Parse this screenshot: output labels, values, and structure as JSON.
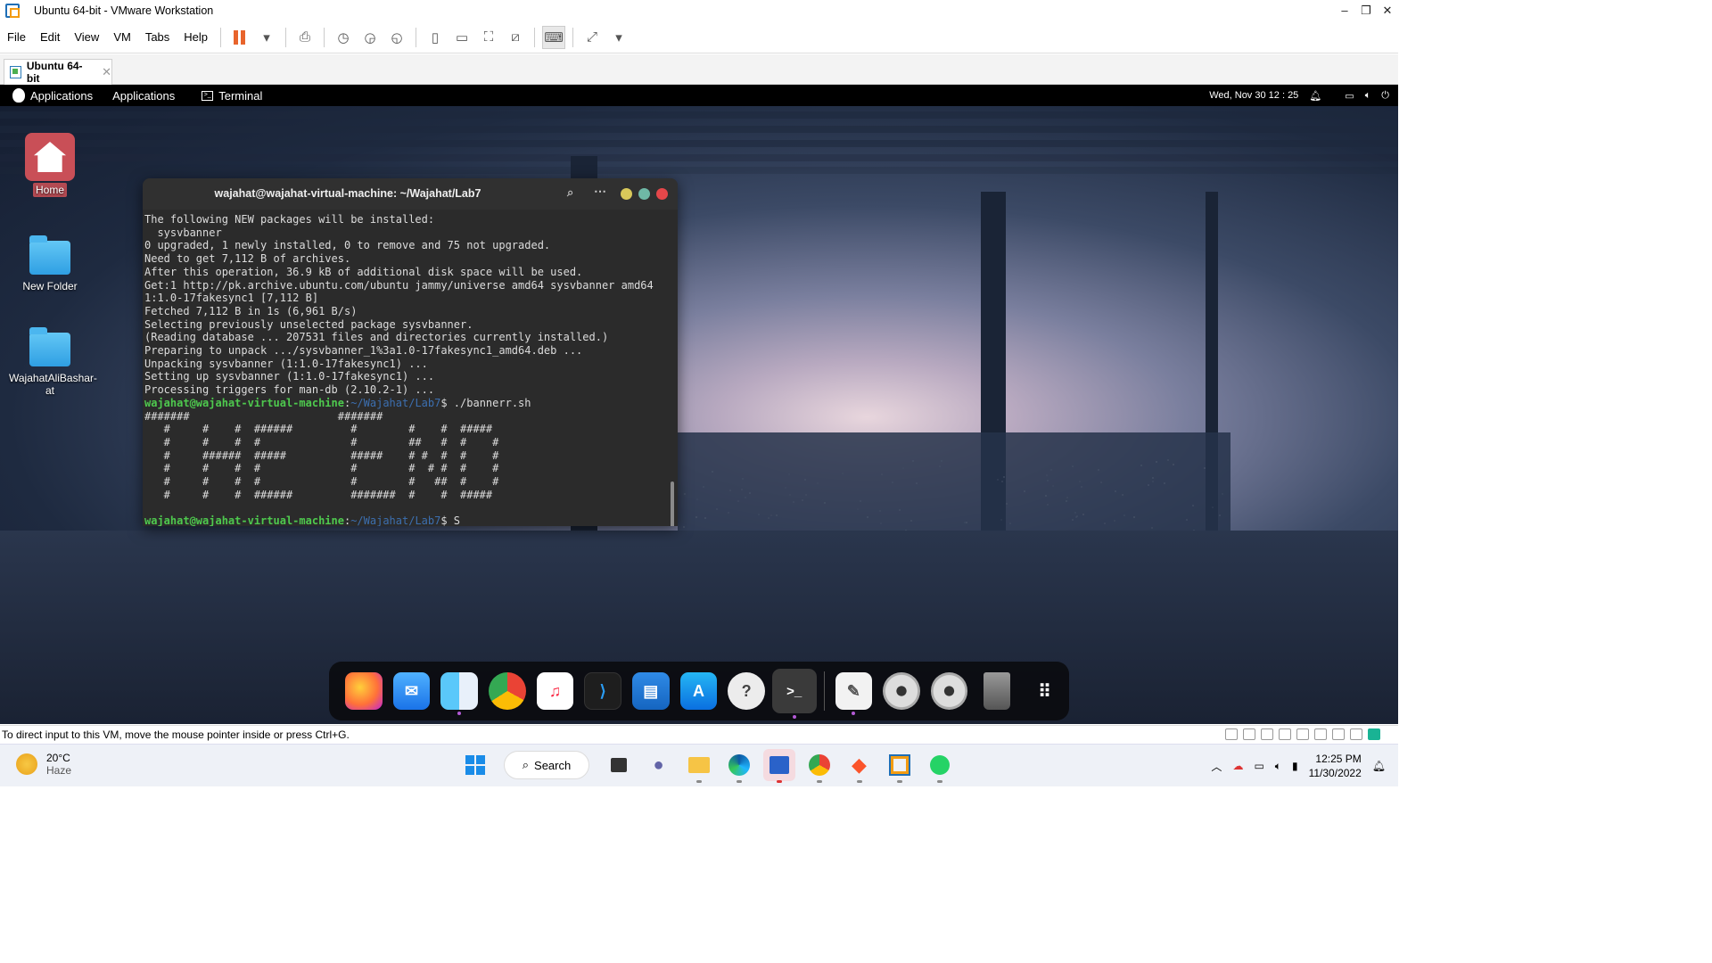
{
  "window": {
    "title": "Ubuntu 64-bit - VMware Workstation",
    "controls": [
      "–",
      "❐",
      "✕"
    ]
  },
  "menu": [
    "File",
    "Edit",
    "View",
    "VM",
    "Tabs",
    "Help"
  ],
  "tab": {
    "label": "Ubuntu 64-bit",
    "close": "✕"
  },
  "gnome_bar": {
    "applications_menu": "Applications",
    "applications2": "Applications",
    "terminal": "Terminal",
    "datetime": "Wed, Nov 30  12 : 25"
  },
  "desktop_icons": [
    {
      "label": "Home"
    },
    {
      "label": "New Folder"
    },
    {
      "label": "WajahatAliBashar-at"
    }
  ],
  "terminal": {
    "title": "wajahat@wajahat-virtual-machine: ~/Wajahat/Lab7",
    "lines": [
      "The following NEW packages will be installed:",
      "  sysvbanner",
      "0 upgraded, 1 newly installed, 0 to remove and 75 not upgraded.",
      "Need to get 7,112 B of archives.",
      "After this operation, 36.9 kB of additional disk space will be used.",
      "Get:1 http://pk.archive.ubuntu.com/ubuntu jammy/universe amd64 sysvbanner amd64",
      "1:1.0-17fakesync1 [7,112 B]",
      "Fetched 7,112 B in 1s (6,961 B/s)",
      "Selecting previously unselected package sysvbanner.",
      "(Reading database ... 207531 files and directories currently installed.)",
      "Preparing to unpack .../sysvbanner_1%3a1.0-17fakesync1_amd64.deb ...",
      "Unpacking sysvbanner (1:1.0-17fakesync1) ...",
      "Setting up sysvbanner (1:1.0-17fakesync1) ...",
      "Processing triggers for man-db (2.10.2-1) ..."
    ],
    "prompt_user": "wajahat@wajahat-virtual-machine",
    "prompt_path": "~/Wajahat/Lab7",
    "command1": "$ ./bannerr.sh",
    "banner": [
      "#######                       #######",
      "   #     #    #  ######         #        #    #  #####",
      "   #     #    #  #              #        ##   #  #    #",
      "   #     ######  #####          #####    # #  #  #    #",
      "   #     #    #  #              #        #  # #  #    #",
      "   #     #    #  #              #        #   ##  #    #",
      "   #     #    #  ######         #######  #    #  #####",
      ""
    ],
    "command2": "$ S"
  },
  "dock": [
    "firefox-icon",
    "mail-icon",
    "finder-icon",
    "chrome-icon",
    "music-icon",
    "vscode-icon",
    "writer-icon",
    "appstore-icon",
    "help-icon",
    "terminal-icon",
    "text-editor-icon",
    "dvd-icon",
    "dvd-icon-2",
    "trash-icon",
    "app-grid-icon"
  ],
  "statusbar": {
    "text": "To direct input to this VM, move the mouse pointer inside or press Ctrl+G."
  },
  "taskbar": {
    "weather_temp": "20°C",
    "weather_desc": "Haze",
    "search": "Search",
    "time": "12:25 PM",
    "date": "11/30/2022"
  }
}
